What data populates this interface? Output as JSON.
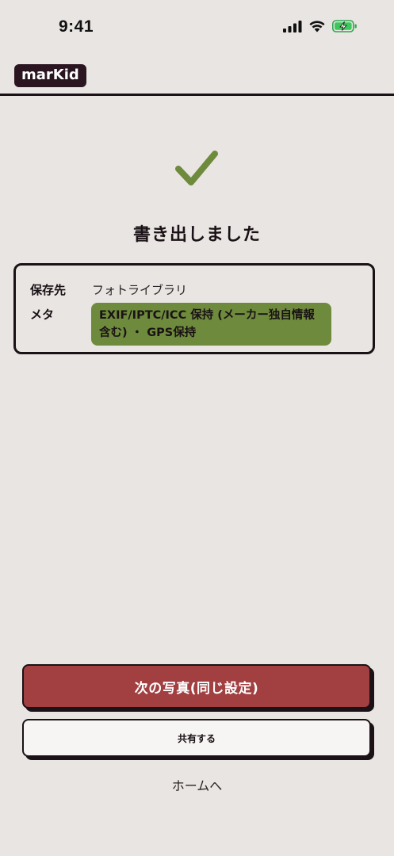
{
  "status_bar": {
    "time": "9:41"
  },
  "header": {
    "logo": "marKid"
  },
  "success": {
    "icon": "checkmark-icon",
    "title": "書き出しました",
    "accent_color": "#6e8a3c"
  },
  "info": {
    "save_label": "保存先",
    "save_value": "フォトライブラリ",
    "meta_label": "メタ",
    "meta_value": "EXIF/IPTC/ICC 保持 (メーカー独自情報含む) ・ GPS保持"
  },
  "actions": {
    "next_label": "次の写真(同じ設定)",
    "share_label": "共有する",
    "home_label": "ホームへ",
    "primary_color": "#a13f41"
  }
}
